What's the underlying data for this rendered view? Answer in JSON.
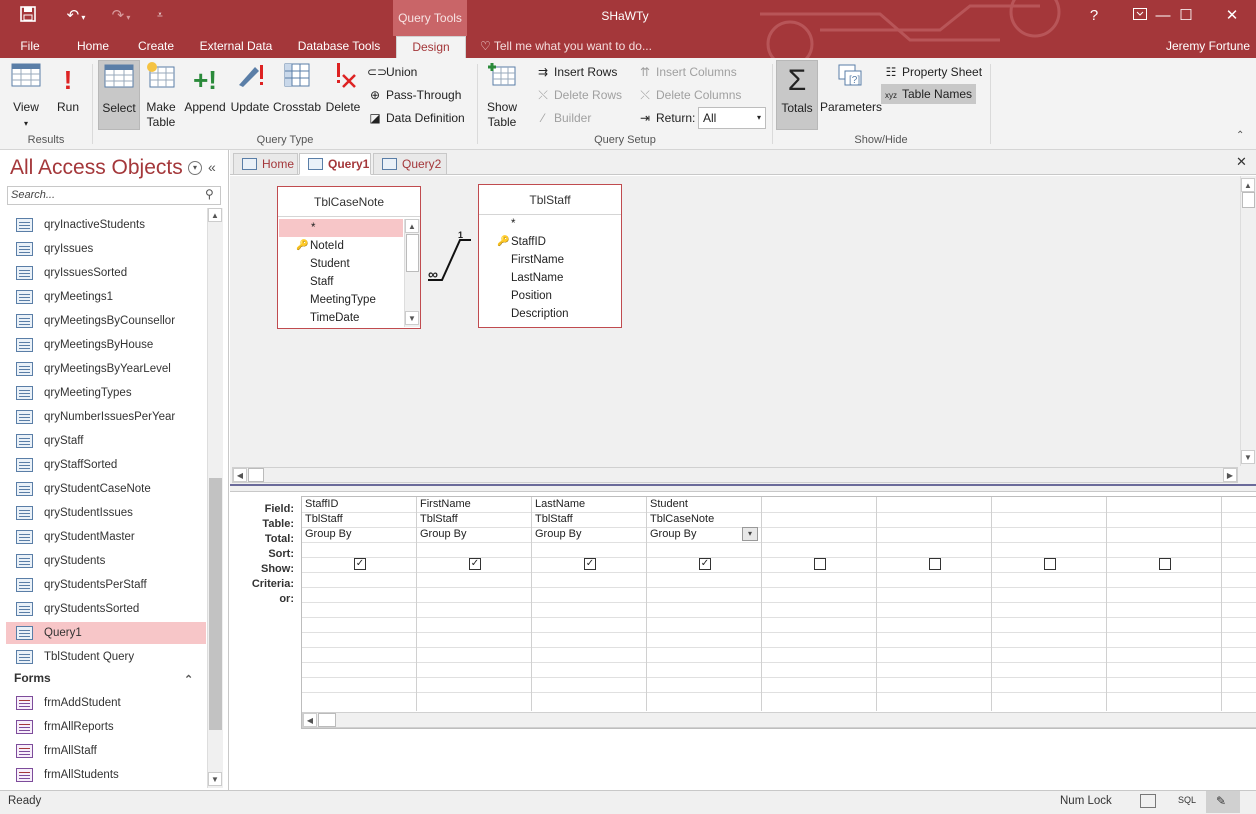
{
  "titlebar": {
    "context_tab": "Query Tools",
    "app_title": "SHaWTy",
    "help": "?",
    "user": "Jeremy Fortune"
  },
  "tabs": [
    "File",
    "Home",
    "Create",
    "External Data",
    "Database Tools",
    "Design"
  ],
  "tell_me": "Tell me what you want to do...",
  "ribbon": {
    "results": {
      "label": "Results",
      "view": "View",
      "run": "Run"
    },
    "query_type": {
      "label": "Query Type",
      "select": "Select",
      "make_table_1": "Make",
      "make_table_2": "Table",
      "append": "Append",
      "update": "Update",
      "crosstab": "Crosstab",
      "delete": "Delete",
      "union": "Union",
      "pass_through": "Pass-Through",
      "data_definition": "Data Definition"
    },
    "query_setup": {
      "label": "Query Setup",
      "show_table_1": "Show",
      "show_table_2": "Table",
      "insert_rows": "Insert Rows",
      "delete_rows": "Delete Rows",
      "builder": "Builder",
      "insert_columns": "Insert Columns",
      "delete_columns": "Delete Columns",
      "return_label": "Return:",
      "return_value": "All"
    },
    "show_hide": {
      "label": "Show/Hide",
      "totals": "Totals",
      "parameters": "Parameters",
      "property_sheet": "Property Sheet",
      "table_names": "Table Names"
    }
  },
  "nav": {
    "title": "All Access Objects",
    "search_placeholder": "Search...",
    "queries": [
      "qryInactiveStudents",
      "qryIssues",
      "qryIssuesSorted",
      "qryMeetings1",
      "qryMeetingsByCounsellor",
      "qryMeetingsByHouse",
      "qryMeetingsByYearLevel",
      "qryMeetingTypes",
      "qryNumberIssuesPerYear",
      "qryStaff",
      "qryStaffSorted",
      "qryStudentCaseNote",
      "qryStudentIssues",
      "qryStudentMaster",
      "qryStudents",
      "qryStudentsPerStaff",
      "qryStudentsSorted",
      "Query1",
      "TblStudent Query"
    ],
    "selected": "Query1",
    "forms_section": "Forms",
    "forms": [
      "frmAddStudent",
      "frmAllReports",
      "frmAllStaff",
      "frmAllStudents"
    ]
  },
  "doc_tabs": [
    "Home",
    "Query1",
    "Query2"
  ],
  "tables": [
    {
      "name": "TblCaseNote",
      "fields": [
        "*",
        "NoteId",
        "Student",
        "Staff",
        "MeetingType",
        "TimeDate"
      ],
      "key": "NoteId"
    },
    {
      "name": "TblStaff",
      "fields": [
        "*",
        "StaffID",
        "FirstName",
        "LastName",
        "Position",
        "Description"
      ],
      "key": "StaffID"
    }
  ],
  "relationship": {
    "one": "1",
    "many": "∞"
  },
  "grid": {
    "row_labels": [
      "Field:",
      "Table:",
      "Total:",
      "Sort:",
      "Show:",
      "Criteria:",
      "or:"
    ],
    "columns": [
      {
        "field": "StaffID",
        "table": "TblStaff",
        "total": "Group By",
        "show": true
      },
      {
        "field": "FirstName",
        "table": "TblStaff",
        "total": "Group By",
        "show": true
      },
      {
        "field": "LastName",
        "table": "TblStaff",
        "total": "Group By",
        "show": true
      },
      {
        "field": "Student",
        "table": "TblCaseNote",
        "total": "Group By",
        "show": true
      },
      {
        "field": "",
        "table": "",
        "total": "",
        "show": false
      },
      {
        "field": "",
        "table": "",
        "total": "",
        "show": false
      },
      {
        "field": "",
        "table": "",
        "total": "",
        "show": false
      },
      {
        "field": "",
        "table": "",
        "total": "",
        "show": false
      }
    ]
  },
  "status": {
    "left": "Ready",
    "num_lock": "Num Lock",
    "sql": "SQL"
  },
  "colors": {
    "accent": "#a4373a",
    "selection": "#f7c6c8"
  }
}
